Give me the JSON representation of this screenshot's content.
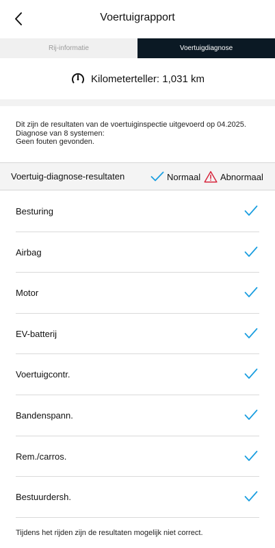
{
  "header": {
    "title": "Voertuigrapport",
    "back_icon": "chevron-left-icon"
  },
  "tabs": [
    {
      "label": "Rij-informatie",
      "active": false
    },
    {
      "label": "Voertuigdiagnose",
      "active": true
    }
  ],
  "odometer": {
    "icon": "speedometer-icon",
    "label": "Kilometerteller: 1,031 km"
  },
  "info": {
    "line1": "Dit zijn de resultaten van de voertuiginspectie uitgevoerd op 04.2025.",
    "line2": "Diagnose van 8 systemen:",
    "line3": "Geen fouten gevonden."
  },
  "results": {
    "title": "Voertuig-diagnose-resultaten",
    "legend_normal": "Normaal",
    "legend_abnormal": "Abnormaal",
    "normal_icon": "checkmark-icon",
    "abnormal_icon": "warning-triangle-icon"
  },
  "systems": [
    {
      "label": "Besturing",
      "status": "Normaal"
    },
    {
      "label": "Airbag",
      "status": "Normaal"
    },
    {
      "label": "Motor",
      "status": "Normaal"
    },
    {
      "label": "EV-batterij",
      "status": "Normaal"
    },
    {
      "label": "Voertuigcontr.",
      "status": "Normaal"
    },
    {
      "label": "Bandenspann.",
      "status": "Normaal"
    },
    {
      "label": "Rem./carros.",
      "status": "Normaal"
    },
    {
      "label": "Bestuurdersh.",
      "status": "Normaal"
    }
  ],
  "footer": {
    "note": "Tijdens het rijden zijn de resultaten mogelijk niet correct."
  },
  "colors": {
    "accent_check": "#1a9ee0",
    "warning": "#d7263d",
    "active_tab_bg": "#0b1924",
    "inactive_tab_bg": "#f0f0f0"
  }
}
